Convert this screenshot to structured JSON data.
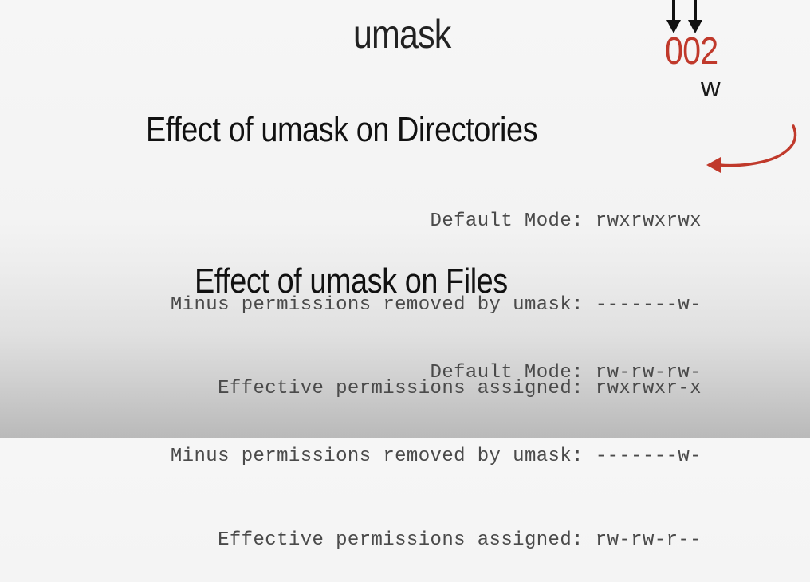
{
  "slide": {
    "title": "umask",
    "umask_value": "002",
    "umask_bit_label": "w"
  },
  "directories": {
    "heading": "Effect of umask on Directories",
    "rows": [
      {
        "label": "Default Mode",
        "value": "rwxrwxrwx"
      },
      {
        "label": "Minus permissions removed by umask",
        "value": "-------w-"
      },
      {
        "label": "Effective permissions assigned",
        "value": "rwxrwxr-x"
      }
    ]
  },
  "files": {
    "heading": "Effect of umask on Files",
    "rows": [
      {
        "label": "Default Mode",
        "value": "rw-rw-rw-"
      },
      {
        "label": "Minus permissions removed by umask",
        "value": "-------w-"
      },
      {
        "label": "Effective permissions assigned",
        "value": "rw-rw-r--"
      }
    ]
  },
  "colors": {
    "accent": "#c0392b",
    "title_text": "#222222",
    "mono_text": "#4a4a4a"
  },
  "icons": [
    "down-arrow-icon",
    "down-arrow-icon",
    "curved-arrow-icon"
  ]
}
